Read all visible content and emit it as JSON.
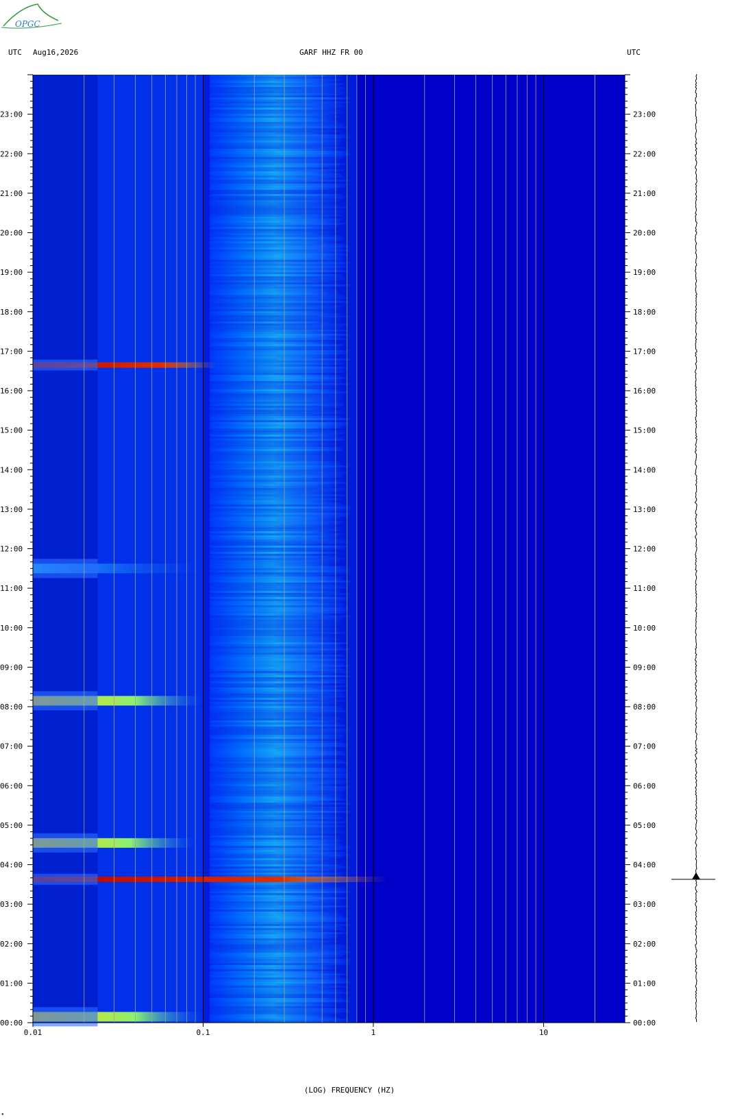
{
  "header": {
    "left_tz": "UTC",
    "date": "Aug16,2026",
    "station": "GARF HHZ FR 00",
    "right_tz": "UTC"
  },
  "logo": {
    "text": "OPGC",
    "color": "#2a7fbf"
  },
  "colors": {
    "background": "#0000c8",
    "grid": "#a0a0a0",
    "major_grid": "#000000"
  },
  "chart_data": {
    "type": "heatmap",
    "xlabel": "(LOG) FREQUENCY (HZ)",
    "x_scale": "log",
    "xlim": [
      0.01,
      30
    ],
    "x_ticks": [
      {
        "value": 0.01,
        "label": "0.01"
      },
      {
        "value": 0.1,
        "label": "0.1"
      },
      {
        "value": 1,
        "label": "1"
      },
      {
        "value": 10,
        "label": "10"
      }
    ],
    "ylim_hours": [
      0,
      24
    ],
    "y_ticks": [
      "00:00",
      "01:00",
      "02:00",
      "03:00",
      "04:00",
      "05:00",
      "06:00",
      "07:00",
      "08:00",
      "09:00",
      "10:00",
      "11:00",
      "12:00",
      "13:00",
      "14:00",
      "15:00",
      "16:00",
      "17:00",
      "18:00",
      "19:00",
      "20:00",
      "21:00",
      "22:00",
      "23:00"
    ],
    "microseism_band_hz": [
      0.12,
      0.5
    ],
    "events": [
      {
        "time_h": 3.63,
        "fmax_hz": 1.2,
        "intensity": "high"
      },
      {
        "time_h": 4.55,
        "fmax_hz": 0.09,
        "intensity": "medium"
      },
      {
        "time_h": 8.15,
        "fmax_hz": 0.1,
        "intensity": "medium"
      },
      {
        "time_h": 11.5,
        "fmax_hz": 0.1,
        "intensity": "low"
      },
      {
        "time_h": 16.65,
        "fmax_hz": 0.12,
        "intensity": "high"
      },
      {
        "time_h": 0.15,
        "fmax_hz": 0.1,
        "intensity": "medium"
      }
    ],
    "trace_event_time_h": 3.63
  }
}
